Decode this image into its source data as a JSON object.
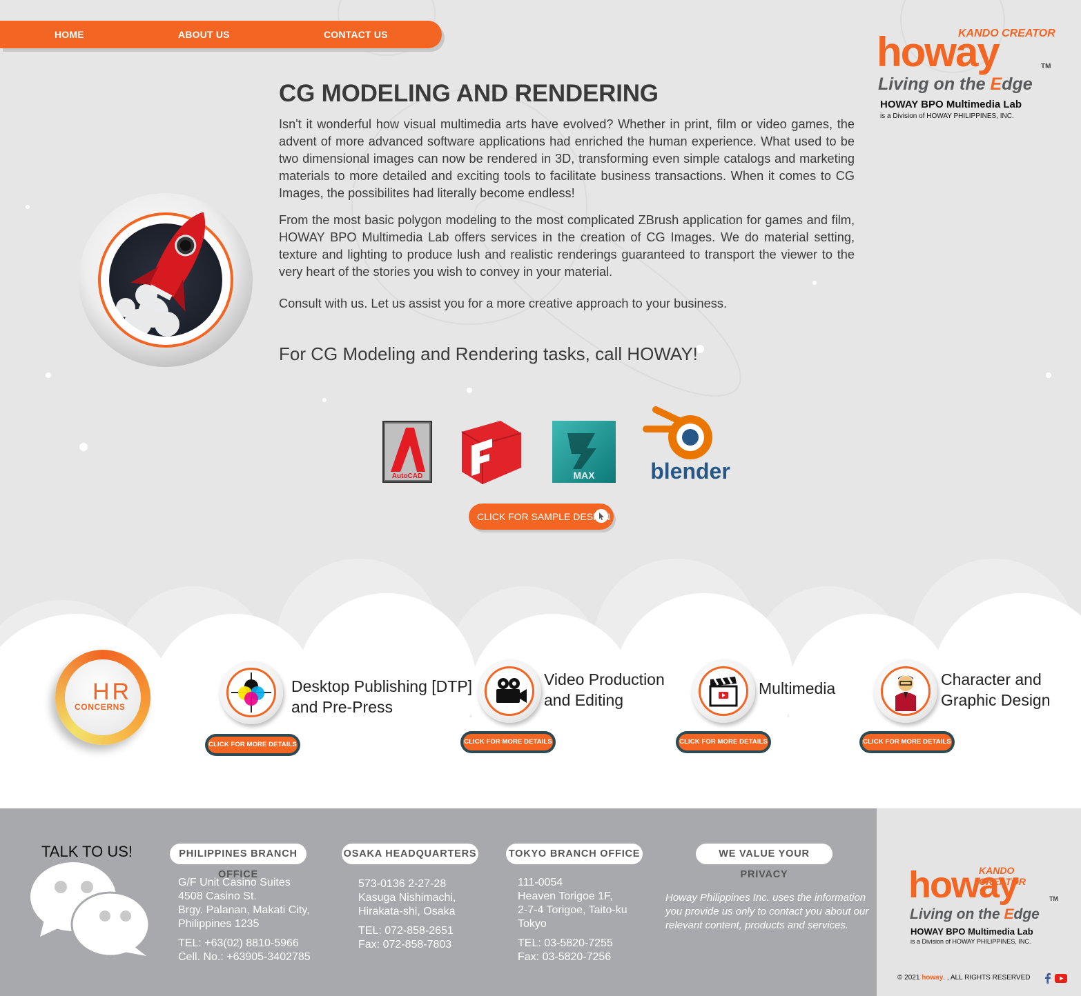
{
  "nav": {
    "items": [
      {
        "label": "HOME"
      },
      {
        "label": "ABOUT US"
      },
      {
        "label": "CONTACT US"
      }
    ]
  },
  "logo": {
    "kando": "KANDO CREATOR",
    "wordmark": "howay",
    "tm": "TM",
    "tagline_prefix": "Living on the ",
    "tagline_e": "E",
    "tagline_suffix": "dge",
    "lab": "HOWAY BPO Multimedia Lab",
    "division": "is a Division of HOWAY PHILIPPINES, INC."
  },
  "main": {
    "title": "CG MODELING AND RENDERING",
    "paragraph1": "Isn't it wonderful how visual multimedia arts have evolved? Whether in print, film or video games, the advent of more advanced software applications had enriched the human experience. What used to be two dimensional images can now be rendered in 3D, transforming even simple catalogs and marketing materials to more detailed and exciting tools to facilitate business transactions. When it comes to CG Images, the possibilites had literally become endless!",
    "paragraph2": "From the most basic polygon modeling to the most complicated ZBrush application for games and film, HOWAY BPO Multimedia Lab offers services in the creation of CG Images. We do material setting, texture and lighting to produce lush and realistic renderings guaranteed to transport the viewer to the very heart of the stories you wish to convey in your material.",
    "consult": "Consult with us. Let us assist you for a more creative approach to your business.",
    "callout": "For CG Modeling and Rendering tasks, call HOWAY!"
  },
  "software": [
    {
      "name": "autocad-logo",
      "label": "AutoCAD"
    },
    {
      "name": "sketchup-logo",
      "label": ""
    },
    {
      "name": "3dsmax-logo",
      "label": "MAX"
    },
    {
      "name": "blender-logo",
      "label": "blender"
    }
  ],
  "sample_button": {
    "label": "CLICK FOR SAMPLE DESIGN"
  },
  "hr": {
    "big": "HR",
    "small": "CONCERNS"
  },
  "services": [
    {
      "title_line1": "Desktop Publishing [DTP]",
      "title_line2": "and Pre-Press",
      "button": "CLICK FOR MORE DETAILS"
    },
    {
      "title_line1": "Video Production",
      "title_line2": "and Editing",
      "button": "CLICK FOR MORE DETAILS"
    },
    {
      "title_line1": "Multimedia",
      "title_line2": "",
      "button": "CLICK FOR MORE DETAILS"
    },
    {
      "title_line1": "Character and",
      "title_line2": "Graphic Design",
      "button": "CLICK FOR MORE DETAILS"
    }
  ],
  "footer": {
    "talk": "TALK TO US!",
    "offices": [
      {
        "heading": "PHILIPPINES BRANCH OFFICE",
        "lines": [
          "G/F Unit Casino Suites",
          "4508 Casino St.",
          "Brgy. Palanan, Makati City,",
          "Philippines 1235"
        ],
        "contacts": [
          "TEL: +63(02) 8810-5966",
          "Cell. No.: +63905-3402785"
        ]
      },
      {
        "heading": "OSAKA HEADQUARTERS",
        "lines": [
          "573-0136 2-27-28",
          "Kasuga Nishimachi,",
          "Hirakata-shi, Osaka"
        ],
        "contacts": [
          "TEL: 072-858-2651",
          "Fax: 072-858-7803"
        ]
      },
      {
        "heading": "TOKYO BRANCH OFFICE",
        "lines": [
          "111-0054",
          "Heaven Torigoe 1F,",
          "2-7-4 Torigoe, Taito-ku",
          "Tokyo"
        ],
        "contacts": [
          "TEL: 03-5820-7255",
          "Fax: 03-5820-7256"
        ]
      }
    ],
    "privacy_heading": "WE VALUE YOUR PRIVACY",
    "privacy_text": " Howay Philippines Inc. uses the information you provide  us only to contact you about our relevant content, products and services.",
    "copyright_prefix": "© 2021",
    "copyright_brand": "howay",
    "copyright_suffix": ". , ALL RIGHTS RESERVED"
  },
  "colors": {
    "accent": "#f26522",
    "footer": "#a7a9ac",
    "background": "#e6e6e6"
  }
}
